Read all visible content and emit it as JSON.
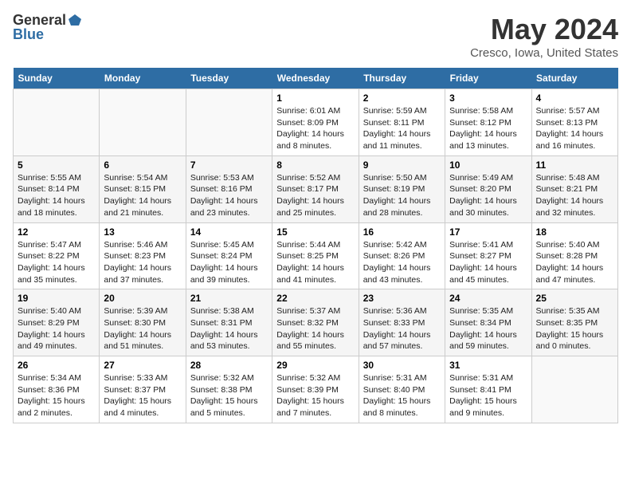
{
  "header": {
    "logo_general": "General",
    "logo_blue": "Blue",
    "month_title": "May 2024",
    "location": "Cresco, Iowa, United States"
  },
  "weekdays": [
    "Sunday",
    "Monday",
    "Tuesday",
    "Wednesday",
    "Thursday",
    "Friday",
    "Saturday"
  ],
  "weeks": [
    [
      {
        "day": "",
        "sunrise": "",
        "sunset": "",
        "daylight": ""
      },
      {
        "day": "",
        "sunrise": "",
        "sunset": "",
        "daylight": ""
      },
      {
        "day": "",
        "sunrise": "",
        "sunset": "",
        "daylight": ""
      },
      {
        "day": "1",
        "sunrise": "Sunrise: 6:01 AM",
        "sunset": "Sunset: 8:09 PM",
        "daylight": "Daylight: 14 hours and 8 minutes."
      },
      {
        "day": "2",
        "sunrise": "Sunrise: 5:59 AM",
        "sunset": "Sunset: 8:11 PM",
        "daylight": "Daylight: 14 hours and 11 minutes."
      },
      {
        "day": "3",
        "sunrise": "Sunrise: 5:58 AM",
        "sunset": "Sunset: 8:12 PM",
        "daylight": "Daylight: 14 hours and 13 minutes."
      },
      {
        "day": "4",
        "sunrise": "Sunrise: 5:57 AM",
        "sunset": "Sunset: 8:13 PM",
        "daylight": "Daylight: 14 hours and 16 minutes."
      }
    ],
    [
      {
        "day": "5",
        "sunrise": "Sunrise: 5:55 AM",
        "sunset": "Sunset: 8:14 PM",
        "daylight": "Daylight: 14 hours and 18 minutes."
      },
      {
        "day": "6",
        "sunrise": "Sunrise: 5:54 AM",
        "sunset": "Sunset: 8:15 PM",
        "daylight": "Daylight: 14 hours and 21 minutes."
      },
      {
        "day": "7",
        "sunrise": "Sunrise: 5:53 AM",
        "sunset": "Sunset: 8:16 PM",
        "daylight": "Daylight: 14 hours and 23 minutes."
      },
      {
        "day": "8",
        "sunrise": "Sunrise: 5:52 AM",
        "sunset": "Sunset: 8:17 PM",
        "daylight": "Daylight: 14 hours and 25 minutes."
      },
      {
        "day": "9",
        "sunrise": "Sunrise: 5:50 AM",
        "sunset": "Sunset: 8:19 PM",
        "daylight": "Daylight: 14 hours and 28 minutes."
      },
      {
        "day": "10",
        "sunrise": "Sunrise: 5:49 AM",
        "sunset": "Sunset: 8:20 PM",
        "daylight": "Daylight: 14 hours and 30 minutes."
      },
      {
        "day": "11",
        "sunrise": "Sunrise: 5:48 AM",
        "sunset": "Sunset: 8:21 PM",
        "daylight": "Daylight: 14 hours and 32 minutes."
      }
    ],
    [
      {
        "day": "12",
        "sunrise": "Sunrise: 5:47 AM",
        "sunset": "Sunset: 8:22 PM",
        "daylight": "Daylight: 14 hours and 35 minutes."
      },
      {
        "day": "13",
        "sunrise": "Sunrise: 5:46 AM",
        "sunset": "Sunset: 8:23 PM",
        "daylight": "Daylight: 14 hours and 37 minutes."
      },
      {
        "day": "14",
        "sunrise": "Sunrise: 5:45 AM",
        "sunset": "Sunset: 8:24 PM",
        "daylight": "Daylight: 14 hours and 39 minutes."
      },
      {
        "day": "15",
        "sunrise": "Sunrise: 5:44 AM",
        "sunset": "Sunset: 8:25 PM",
        "daylight": "Daylight: 14 hours and 41 minutes."
      },
      {
        "day": "16",
        "sunrise": "Sunrise: 5:42 AM",
        "sunset": "Sunset: 8:26 PM",
        "daylight": "Daylight: 14 hours and 43 minutes."
      },
      {
        "day": "17",
        "sunrise": "Sunrise: 5:41 AM",
        "sunset": "Sunset: 8:27 PM",
        "daylight": "Daylight: 14 hours and 45 minutes."
      },
      {
        "day": "18",
        "sunrise": "Sunrise: 5:40 AM",
        "sunset": "Sunset: 8:28 PM",
        "daylight": "Daylight: 14 hours and 47 minutes."
      }
    ],
    [
      {
        "day": "19",
        "sunrise": "Sunrise: 5:40 AM",
        "sunset": "Sunset: 8:29 PM",
        "daylight": "Daylight: 14 hours and 49 minutes."
      },
      {
        "day": "20",
        "sunrise": "Sunrise: 5:39 AM",
        "sunset": "Sunset: 8:30 PM",
        "daylight": "Daylight: 14 hours and 51 minutes."
      },
      {
        "day": "21",
        "sunrise": "Sunrise: 5:38 AM",
        "sunset": "Sunset: 8:31 PM",
        "daylight": "Daylight: 14 hours and 53 minutes."
      },
      {
        "day": "22",
        "sunrise": "Sunrise: 5:37 AM",
        "sunset": "Sunset: 8:32 PM",
        "daylight": "Daylight: 14 hours and 55 minutes."
      },
      {
        "day": "23",
        "sunrise": "Sunrise: 5:36 AM",
        "sunset": "Sunset: 8:33 PM",
        "daylight": "Daylight: 14 hours and 57 minutes."
      },
      {
        "day": "24",
        "sunrise": "Sunrise: 5:35 AM",
        "sunset": "Sunset: 8:34 PM",
        "daylight": "Daylight: 14 hours and 59 minutes."
      },
      {
        "day": "25",
        "sunrise": "Sunrise: 5:35 AM",
        "sunset": "Sunset: 8:35 PM",
        "daylight": "Daylight: 15 hours and 0 minutes."
      }
    ],
    [
      {
        "day": "26",
        "sunrise": "Sunrise: 5:34 AM",
        "sunset": "Sunset: 8:36 PM",
        "daylight": "Daylight: 15 hours and 2 minutes."
      },
      {
        "day": "27",
        "sunrise": "Sunrise: 5:33 AM",
        "sunset": "Sunset: 8:37 PM",
        "daylight": "Daylight: 15 hours and 4 minutes."
      },
      {
        "day": "28",
        "sunrise": "Sunrise: 5:32 AM",
        "sunset": "Sunset: 8:38 PM",
        "daylight": "Daylight: 15 hours and 5 minutes."
      },
      {
        "day": "29",
        "sunrise": "Sunrise: 5:32 AM",
        "sunset": "Sunset: 8:39 PM",
        "daylight": "Daylight: 15 hours and 7 minutes."
      },
      {
        "day": "30",
        "sunrise": "Sunrise: 5:31 AM",
        "sunset": "Sunset: 8:40 PM",
        "daylight": "Daylight: 15 hours and 8 minutes."
      },
      {
        "day": "31",
        "sunrise": "Sunrise: 5:31 AM",
        "sunset": "Sunset: 8:41 PM",
        "daylight": "Daylight: 15 hours and 9 minutes."
      },
      {
        "day": "",
        "sunrise": "",
        "sunset": "",
        "daylight": ""
      }
    ]
  ]
}
